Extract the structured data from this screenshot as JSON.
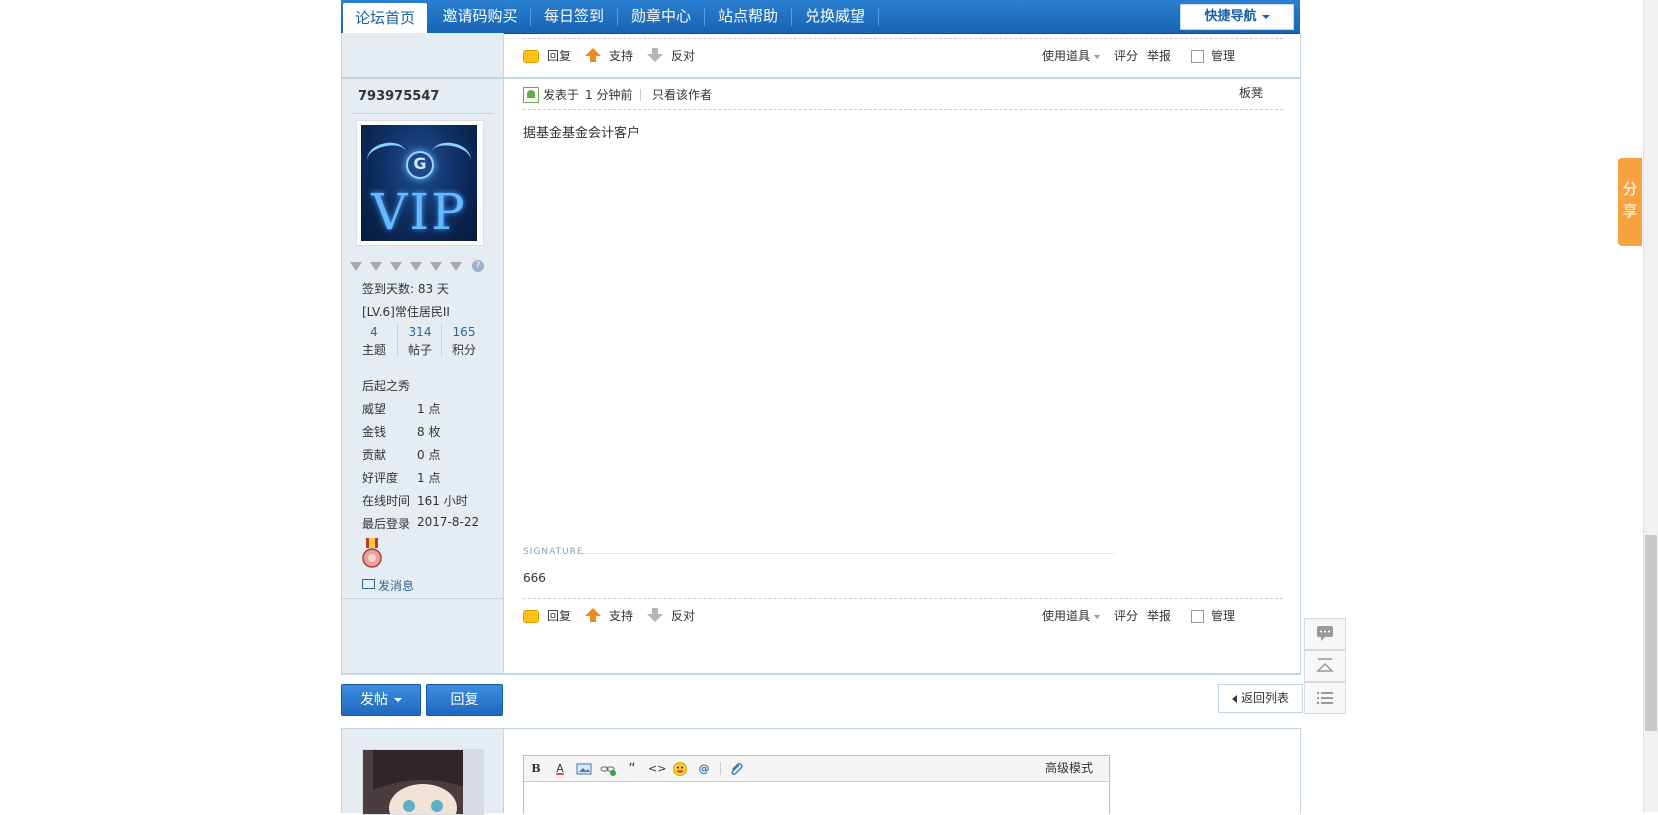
{
  "nav": {
    "items": [
      "论坛首页",
      "邀请码购买",
      "每日签到",
      "勋章中心",
      "站点帮助",
      "兑换威望"
    ],
    "quick_nav": "快捷导航"
  },
  "actions": {
    "reply": "回复",
    "support": "支持",
    "oppose": "反对",
    "use_tool": "使用道具",
    "rate": "评分",
    "report": "举报",
    "manage": "管理"
  },
  "profile": {
    "username": "793975547",
    "vip_text": "VIP",
    "vip_emblem": "G",
    "help_badge": "?",
    "checkin_days": "签到天数: 83 天",
    "level": "[LV.6]常住居民II",
    "stats": [
      {
        "value": "4",
        "label": "主题"
      },
      {
        "value": "314",
        "label": "帖子"
      },
      {
        "value": "165",
        "label": "积分"
      }
    ],
    "title": "后起之秀",
    "fields": [
      {
        "label": "威望",
        "value": "1 点"
      },
      {
        "label": "金钱",
        "value": "8 枚"
      },
      {
        "label": "贡献",
        "value": "0 点"
      },
      {
        "label": "好评度",
        "value": "1 点"
      },
      {
        "label": "在线时间",
        "value": "161 小时"
      },
      {
        "label": "最后登录",
        "value": "2017-8-22"
      }
    ],
    "send_message": "发消息"
  },
  "post": {
    "posted_prefix": "发表于",
    "posted_time": "1 分钟前",
    "author_only": "只看该作者",
    "floor": "板凳",
    "content": "据基金基金会计客户",
    "signature_label": "SIGNATURE",
    "signature": "666"
  },
  "bottom": {
    "new_post": "发帖",
    "reply": "回复",
    "back_to_list": "返回列表"
  },
  "editor": {
    "advanced_mode": "高级模式",
    "toolbar_icons": [
      "bold-icon",
      "font-color-icon",
      "image-icon",
      "link-icon",
      "quote-icon",
      "code-icon",
      "emoticon-icon",
      "mention-icon",
      "attachment-icon"
    ],
    "bold": "B",
    "font_color": "A",
    "quote": "“",
    "code": "<>",
    "mention": "@"
  },
  "float": {
    "share": "分享"
  },
  "colors": {
    "nav_blue": "#1c6cc0",
    "side_bg": "#e5edf2",
    "share_orange": "#f7a23e",
    "link_blue": "#336699"
  }
}
